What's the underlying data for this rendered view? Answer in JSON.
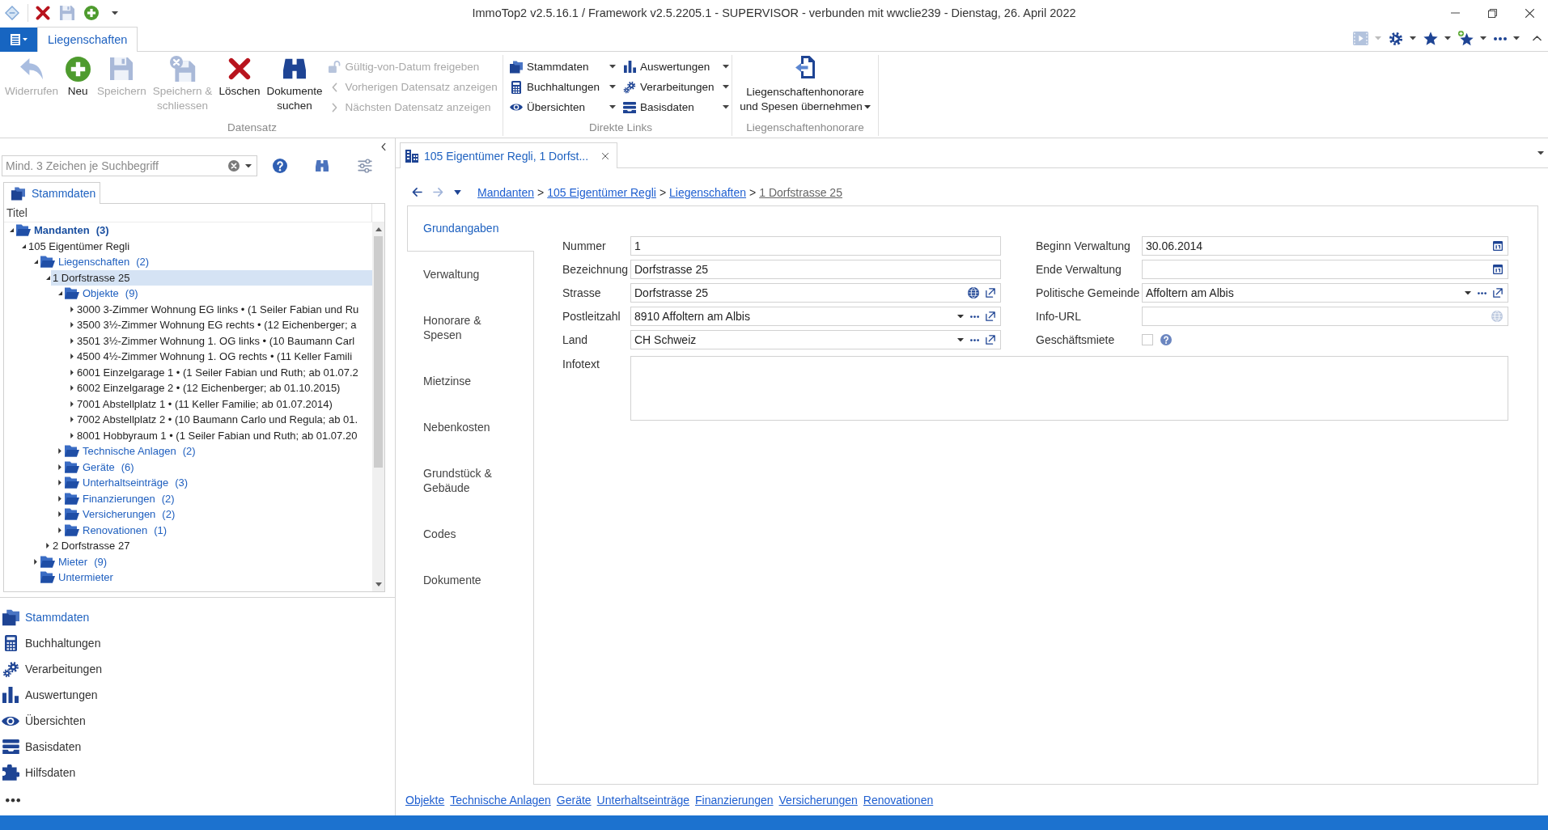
{
  "window": {
    "title": "ImmoTop2 v2.5.16.1 / Framework v2.5.2205.1 - SUPERVISOR - verbunden mit wwclie239 - Dienstag, 26. April 2022"
  },
  "quick_access": [
    {
      "kind": "delete",
      "disabled": false
    },
    {
      "kind": "save",
      "disabled": true
    },
    {
      "kind": "add",
      "disabled": false
    }
  ],
  "ribbon": {
    "tabs": [
      {
        "label": "Liegenschaften",
        "selected": true
      }
    ],
    "tools": [
      {
        "kind": "media",
        "disabled": true
      },
      {
        "kind": "gear",
        "disabled": false
      },
      {
        "kind": "star",
        "disabled": false
      },
      {
        "kind": "star-add",
        "disabled": false
      },
      {
        "kind": "more",
        "disabled": false
      }
    ],
    "record_group": {
      "label": "Datensatz",
      "buttons": [
        {
          "label": "Widerrufen",
          "kind": "undo",
          "disabled": true
        },
        {
          "label": "Neu",
          "kind": "add",
          "disabled": false
        },
        {
          "label": "Speichern",
          "kind": "save",
          "disabled": true
        },
        {
          "label": "Speichern &\nschliessen",
          "kind": "save-close",
          "disabled": true
        },
        {
          "label": "Löschen",
          "kind": "delete",
          "disabled": false
        },
        {
          "label": "Dokumente\nsuchen",
          "kind": "find",
          "disabled": false
        }
      ],
      "small_buttons": [
        {
          "label": "Gültig-von-Datum freigeben",
          "kind": "unlock",
          "disabled": true
        },
        {
          "label": "Vorherigen Datensatz anzeigen",
          "kind": "previous",
          "disabled": true
        },
        {
          "label": "Nächsten Datensatz anzeigen",
          "kind": "next",
          "disabled": true
        }
      ]
    },
    "links_group": {
      "label": "Direkte Links",
      "links": [
        {
          "label": "Stammdaten",
          "kind": "folders"
        },
        {
          "label": "Buchhaltungen",
          "kind": "calculator"
        },
        {
          "label": "Übersichten",
          "kind": "eye"
        },
        {
          "label": "Auswertungen",
          "kind": "chart"
        },
        {
          "label": "Verarbeitungen",
          "kind": "gears"
        },
        {
          "label": "Basisdaten",
          "kind": "tray"
        }
      ]
    },
    "fees_group": {
      "label": "Liegenschaftenhonorare",
      "button": {
        "label": "Liegenschaftenhonorare\nund Spesen übernehmen"
      }
    }
  },
  "sidebar": {
    "search": {
      "placeholder": "Mind. 3 Zeichen je Suchbegriff"
    },
    "tabs": [
      {
        "label": "Stammdaten",
        "selected": true
      }
    ],
    "tree": {
      "column": "Titel",
      "nodes": [
        {
          "label": "Mandanten",
          "count": "(3)",
          "kind": "folder",
          "expanded": true,
          "selected": false,
          "children": [
            {
              "label": "105 Eigentümer Regli",
              "kind": "item",
              "expanded": true,
              "selected": false,
              "children": [
                {
                  "label": "Liegenschaften",
                  "count": "(2)",
                  "kind": "folder",
                  "expanded": true,
                  "selected": false,
                  "children": [
                    {
                      "label": "1 Dorfstrasse 25",
                      "kind": "item",
                      "expanded": true,
                      "selected": true,
                      "children": [
                        {
                          "label": "Objekte",
                          "count": "(9)",
                          "kind": "folder",
                          "expanded": true,
                          "selected": false,
                          "children": [
                            {
                              "label": "3000 3-Zimmer Wohnung EG links • (1 Seiler Fabian und Ru",
                              "kind": "item",
                              "expanded": false,
                              "selected": false
                            },
                            {
                              "label": "3500 3½-Zimmer Wohnung EG rechts • (12 Eichenberger; a",
                              "kind": "item",
                              "expanded": false,
                              "selected": false
                            },
                            {
                              "label": "3501 3½-Zimmer Wohnung 1. OG links • (10 Baumann Carl",
                              "kind": "item",
                              "expanded": false,
                              "selected": false
                            },
                            {
                              "label": "4500 4½-Zimmer Wohnung 1. OG rechts • (11 Keller Famili",
                              "kind": "item",
                              "expanded": false,
                              "selected": false
                            },
                            {
                              "label": "6001 Einzelgarage 1 • (1 Seiler Fabian und Ruth; ab 01.07.2",
                              "kind": "item",
                              "expanded": false,
                              "selected": false
                            },
                            {
                              "label": "6002 Einzelgarage 2 • (12 Eichenberger; ab 01.10.2015)",
                              "kind": "item",
                              "expanded": false,
                              "selected": false
                            },
                            {
                              "label": "7001 Abstellplatz 1 • (11 Keller Familie; ab 01.07.2014)",
                              "kind": "item",
                              "expanded": false,
                              "selected": false
                            },
                            {
                              "label": "7002 Abstellplatz 2 • (10 Baumann Carlo und Regula; ab 01.",
                              "kind": "item",
                              "expanded": false,
                              "selected": false
                            },
                            {
                              "label": "8001 Hobbyraum 1 • (1 Seiler Fabian und Ruth; ab 01.07.20",
                              "kind": "item",
                              "expanded": false,
                              "selected": false
                            }
                          ]
                        },
                        {
                          "label": "Technische Anlagen",
                          "count": "(2)",
                          "kind": "folder",
                          "expanded": false,
                          "selected": false
                        },
                        {
                          "label": "Geräte",
                          "count": "(6)",
                          "kind": "folder",
                          "expanded": false,
                          "selected": false
                        },
                        {
                          "label": "Unterhaltseinträge",
                          "count": "(3)",
                          "kind": "folder",
                          "expanded": false,
                          "selected": false
                        },
                        {
                          "label": "Finanzierungen",
                          "count": "(2)",
                          "kind": "folder",
                          "expanded": false,
                          "selected": false
                        },
                        {
                          "label": "Versicherungen",
                          "count": "(2)",
                          "kind": "folder",
                          "expanded": false,
                          "selected": false
                        },
                        {
                          "label": "Renovationen",
                          "count": "(1)",
                          "kind": "folder",
                          "expanded": false,
                          "selected": false
                        }
                      ]
                    },
                    {
                      "label": "2 Dorfstrasse 27",
                      "kind": "item",
                      "expanded": false,
                      "selected": false
                    }
                  ]
                },
                {
                  "label": "Mieter",
                  "count": "(9)",
                  "kind": "folder",
                  "expanded": false,
                  "selected": false
                },
                {
                  "label": "Untermieter",
                  "kind": "folder",
                  "selected": false
                }
              ]
            }
          ]
        }
      ]
    },
    "nav": [
      {
        "label": "Stammdaten",
        "kind": "folders",
        "selected": true
      },
      {
        "label": "Buchhaltungen",
        "kind": "calculator",
        "selected": false
      },
      {
        "label": "Verarbeitungen",
        "kind": "gears",
        "selected": false
      },
      {
        "label": "Auswertungen",
        "kind": "chart",
        "selected": false
      },
      {
        "label": "Übersichten",
        "kind": "eye",
        "selected": false
      },
      {
        "label": "Basisdaten",
        "kind": "tray",
        "selected": false
      },
      {
        "label": "Hilfsdaten",
        "kind": "puzzle",
        "selected": false
      }
    ]
  },
  "document_tabs": [
    {
      "title": "105 Eigentümer Regli, 1 Dorfst...",
      "selected": true
    }
  ],
  "history_buttons": [
    {
      "kind": "back",
      "disabled": false
    },
    {
      "kind": "forward",
      "disabled": true
    },
    {
      "kind": "history",
      "disabled": false
    }
  ],
  "breadcrumb": {
    "separator": ">",
    "items": [
      {
        "label": "Mandanten",
        "current": false
      },
      {
        "label": "105 Eigentümer Regli",
        "current": false
      },
      {
        "label": "Liegenschaften",
        "current": false
      },
      {
        "label": "1 Dorfstrasse 25",
        "current": true
      }
    ]
  },
  "sections": [
    {
      "label": "Grundangaben",
      "selected": true
    },
    {
      "label": "Verwaltung",
      "selected": false
    },
    {
      "label": "Honorare & Spesen",
      "selected": false
    },
    {
      "label": "Mietzinse",
      "selected": false
    },
    {
      "label": "Nebenkosten",
      "selected": false
    },
    {
      "label": "Grundstück & Gebäude",
      "selected": false
    },
    {
      "label": "Codes",
      "selected": false
    },
    {
      "label": "Dokumente",
      "selected": false
    }
  ],
  "form": {
    "left": [
      {
        "label": "Nummer",
        "kind": "text",
        "value": "1"
      },
      {
        "label": "Bezeichnung",
        "kind": "text",
        "value": "Dorfstrasse 25"
      },
      {
        "label": "Strasse",
        "kind": "address",
        "value": "Dorfstrasse 25"
      },
      {
        "label": "Postleitzahl",
        "kind": "lookup",
        "value": "8910 Affoltern am Albis"
      },
      {
        "label": "Land",
        "kind": "lookup",
        "value": "CH Schweiz"
      }
    ],
    "right": [
      {
        "label": "Beginn Verwaltung",
        "kind": "date",
        "value": "30.06.2014"
      },
      {
        "label": "Ende Verwaltung",
        "kind": "date"
      },
      {
        "label": "Politische Gemeinde",
        "kind": "lookup",
        "value": "Affoltern am Albis"
      },
      {
        "label": "Info-URL",
        "kind": "url"
      },
      {
        "label": "Geschäftsmiete",
        "kind": "checkbox",
        "checked": false
      }
    ],
    "infotext": {
      "label": "Infotext"
    }
  },
  "related_links": [
    "Objekte",
    "Technische Anlagen",
    "Geräte",
    "Unterhaltseinträge",
    "Finanzierungen",
    "Versicherungen",
    "Renovationen"
  ]
}
